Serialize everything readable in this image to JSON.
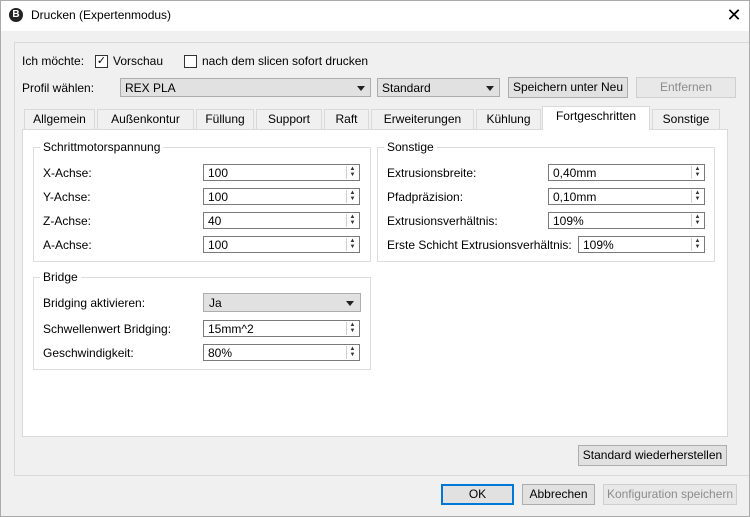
{
  "window": {
    "title": "Drucken (Expertenmodus)",
    "app_icon": "B"
  },
  "top": {
    "want_label": "Ich möchte:",
    "preview_label": "Vorschau",
    "print_label": "nach dem slicen sofort drucken",
    "preview_checked": "✓"
  },
  "profile": {
    "label": "Profil wählen:",
    "selected": "REX PLA",
    "quality": "Standard",
    "save_as": "Speichern unter Neu",
    "remove": "Entfernen"
  },
  "tabs": [
    "Allgemein",
    "Außenkontur",
    "Füllung",
    "Support",
    "Raft",
    "Erweiterungen",
    "Kühlung",
    "Fortgeschritten",
    "Sonstige"
  ],
  "stepper": {
    "title": "Schrittmotorspannung",
    "rows": [
      {
        "label": "X-Achse:",
        "value": "100"
      },
      {
        "label": "Y-Achse:",
        "value": "100"
      },
      {
        "label": "Z-Achse:",
        "value": "40"
      },
      {
        "label": "A-Achse:",
        "value": "100"
      }
    ]
  },
  "bridge": {
    "title": "Bridge",
    "enable_label": "Bridging aktivieren:",
    "enable_value": "Ja",
    "threshold_label": "Schwellenwert Bridging:",
    "threshold_value": "15mm^2",
    "speed_label": "Geschwindigkeit:",
    "speed_value": "80%"
  },
  "misc": {
    "title": "Sonstige",
    "rows": [
      {
        "label": "Extrusionsbreite:",
        "value": "0,40mm"
      },
      {
        "label": "Pfadpräzision:",
        "value": "0,10mm"
      },
      {
        "label": "Extrusionsverhältnis:",
        "value": "109%"
      },
      {
        "label": "Erste Schicht Extrusionsverhältnis:",
        "value": "109%"
      }
    ]
  },
  "buttons": {
    "restore": "Standard wiederherstellen",
    "ok": "OK",
    "cancel": "Abbrechen",
    "save_config": "Konfiguration speichern"
  }
}
